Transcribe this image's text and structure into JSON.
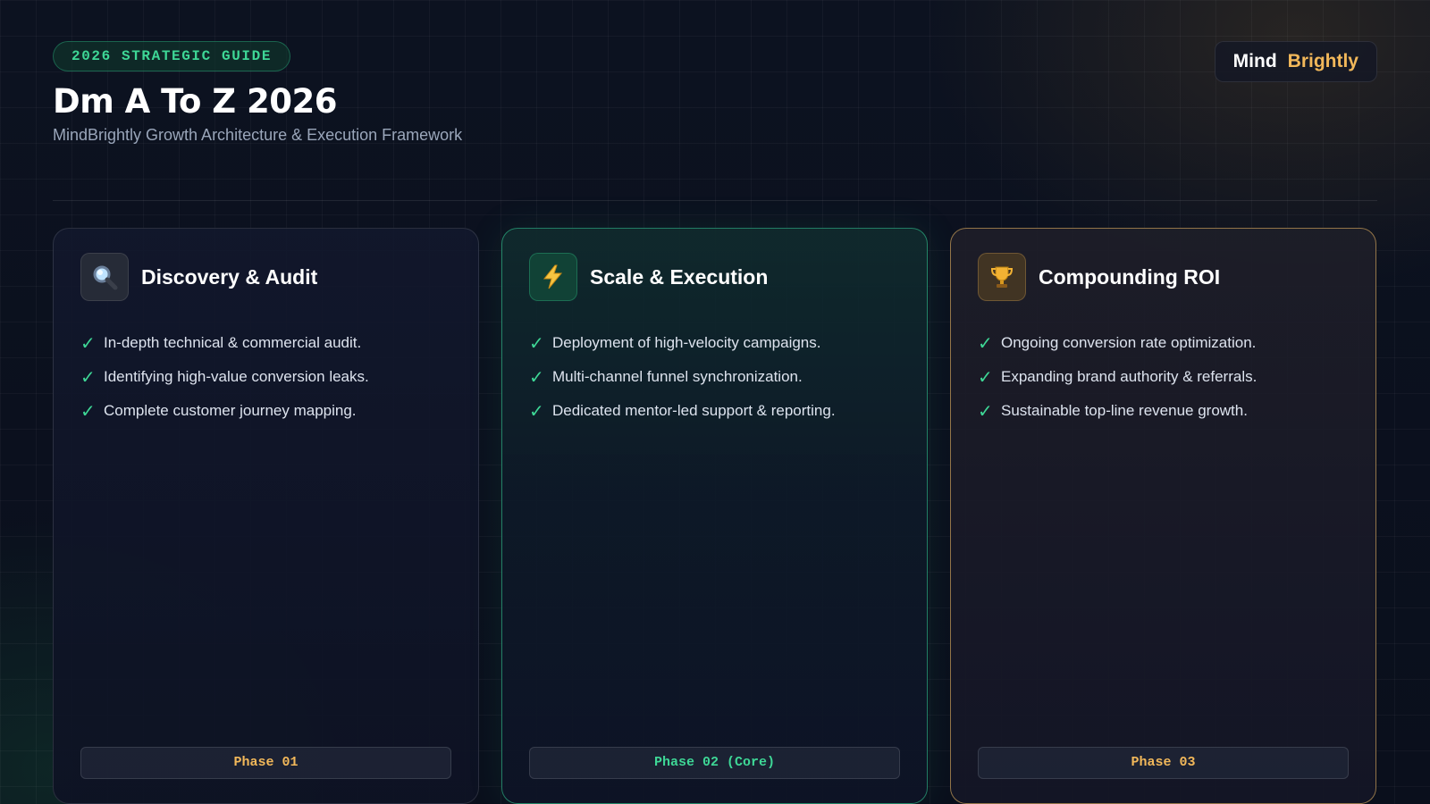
{
  "header": {
    "badge": "2026 STRATEGIC GUIDE",
    "title": "Dm A To Z 2026",
    "subtitle": "MindBrightly Growth Architecture & Execution Framework",
    "brand": {
      "part1": "Mind",
      "part2": "Brightly"
    }
  },
  "colors": {
    "accent_green": "#3ed796",
    "accent_gold": "#f2b85a",
    "background": "#0a0f1c"
  },
  "cards": [
    {
      "icon": "magnifier-icon",
      "title": "Discovery & Audit",
      "items": [
        "In-depth technical & commercial audit.",
        "Identifying high-value conversion leaks.",
        "Complete customer journey mapping."
      ],
      "phase": "Phase 01"
    },
    {
      "icon": "lightning-icon",
      "title": "Scale & Execution",
      "items": [
        "Deployment of high-velocity campaigns.",
        "Multi-channel funnel synchronization.",
        "Dedicated mentor-led support & reporting."
      ],
      "phase": "Phase 02 (Core)"
    },
    {
      "icon": "trophy-icon",
      "title": "Compounding ROI",
      "items": [
        "Ongoing conversion rate optimization.",
        "Expanding brand authority & referrals.",
        "Sustainable top-line revenue growth."
      ],
      "phase": "Phase 03"
    }
  ]
}
